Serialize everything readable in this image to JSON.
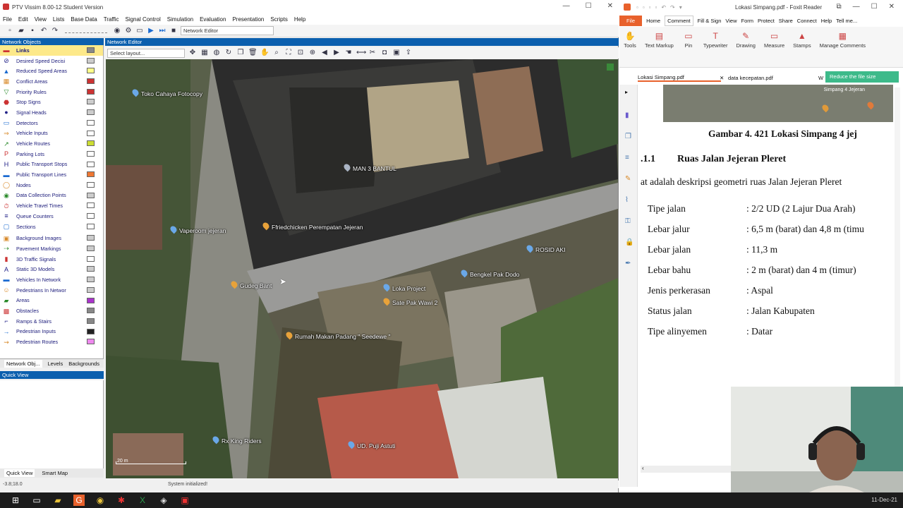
{
  "vissim": {
    "title": "PTV Vissim 8.00-12 Student Version",
    "menu": [
      "File",
      "Edit",
      "View",
      "Lists",
      "Base Data",
      "Traffic",
      "Signal Control",
      "Simulation",
      "Evaluation",
      "Presentation",
      "Scripts",
      "Help"
    ],
    "toolbar_combo": "Network Editor",
    "panel_network_objects": "Network Objects",
    "panel_network_editor": "Network Editor",
    "layout_select": "Select layout...",
    "network_objects": [
      {
        "label": "Links",
        "icon": "link-icon",
        "selected": true
      },
      {
        "label": "Desired Speed Decisi",
        "icon": "speed-sign-icon"
      },
      {
        "label": "Reduced Speed Areas",
        "icon": "warning-sign-icon"
      },
      {
        "label": "Conflict Areas",
        "icon": "conflict-icon"
      },
      {
        "label": "Priority Rules",
        "icon": "priority-icon"
      },
      {
        "label": "Stop Signs",
        "icon": "stop-icon"
      },
      {
        "label": "Signal Heads",
        "icon": "signal-head-icon"
      },
      {
        "label": "Detectors",
        "icon": "detector-icon"
      },
      {
        "label": "Vehicle Inputs",
        "icon": "vehicle-input-icon"
      },
      {
        "label": "Vehicle Routes",
        "icon": "route-icon"
      },
      {
        "label": "Parking Lots",
        "icon": "parking-icon"
      },
      {
        "label": "Public Transport Stops",
        "icon": "bus-stop-icon"
      },
      {
        "label": "Public Transport Lines",
        "icon": "bus-line-icon"
      },
      {
        "label": "Nodes",
        "icon": "node-icon"
      },
      {
        "label": "Data Collection Points",
        "icon": "collection-icon"
      },
      {
        "label": "Vehicle Travel Times",
        "icon": "travel-time-icon"
      },
      {
        "label": "Queue Counters",
        "icon": "queue-icon"
      },
      {
        "label": "Sections",
        "icon": "section-icon"
      },
      {
        "label": "Background Images",
        "icon": "image-icon"
      },
      {
        "label": "Pavement Markings",
        "icon": "marking-icon"
      },
      {
        "label": "3D Traffic Signals",
        "icon": "3d-signal-icon"
      },
      {
        "label": "Static 3D Models",
        "icon": "3d-model-icon"
      },
      {
        "label": "Vehicles In Network",
        "icon": "vehicle-icon"
      },
      {
        "label": "Pedestrians In Networ",
        "icon": "pedestrian-icon"
      },
      {
        "label": "Areas",
        "icon": "area-icon"
      },
      {
        "label": "Obstacles",
        "icon": "obstacle-icon"
      },
      {
        "label": "Ramps & Stairs",
        "icon": "stairs-icon"
      },
      {
        "label": "Pedestrian Inputs",
        "icon": "ped-input-icon"
      },
      {
        "label": "Pedestrian Routes",
        "icon": "ped-route-icon"
      }
    ],
    "left_tabs": [
      "Network Obj...",
      "Levels",
      "Backgrounds"
    ],
    "quick_view_title": "Quick View",
    "bottom_tabs": [
      "Quick View",
      "Smart Map"
    ],
    "status_left": "-3.8;18.0",
    "status_center": "System initialized!",
    "scale_label": "20 m",
    "map_places": [
      {
        "label": "Toko Cahaya Fotocopy",
        "kind": "shop"
      },
      {
        "label": "MAN 3 BANTUL",
        "kind": "school"
      },
      {
        "label": "Vaperoom jejeran",
        "kind": "shop"
      },
      {
        "label": "Ffriedchicken Perempatan Jejeran",
        "kind": "food"
      },
      {
        "label": "ROSID AKI",
        "kind": "shop"
      },
      {
        "label": "Bengkel Pak Dodo",
        "kind": "shop"
      },
      {
        "label": "Gudeg Bant",
        "kind": "food"
      },
      {
        "label": "Loka Project",
        "kind": "shop"
      },
      {
        "label": "Sate Pak Wawi 2",
        "kind": "food"
      },
      {
        "label": "Rumah Makan Padang \" Seedewe \"",
        "kind": "food"
      },
      {
        "label": "Rx King Riders",
        "kind": "shop"
      },
      {
        "label": "UD. Puji Astuti",
        "kind": "shop"
      }
    ]
  },
  "foxit": {
    "title": "Lokasi Simpang.pdf - Foxit Reader",
    "tabs": [
      "File",
      "Home",
      "Comment",
      "Fill & Sign",
      "View",
      "Form",
      "Protect",
      "Share",
      "Connect",
      "Help",
      "Tell me..."
    ],
    "active_tab": "Comment",
    "ribbon": [
      {
        "label": "Tools",
        "icon": "hand-icon"
      },
      {
        "label": "Text Markup",
        "icon": "text-markup-icon"
      },
      {
        "label": "Pin",
        "icon": "pin-icon"
      },
      {
        "label": "Typewriter",
        "icon": "typewriter-icon"
      },
      {
        "label": "Drawing",
        "icon": "pencil-icon"
      },
      {
        "label": "Measure",
        "icon": "ruler-icon"
      },
      {
        "label": "Stamps",
        "icon": "stamp-icon"
      },
      {
        "label": "Manage Comments",
        "icon": "comments-icon"
      }
    ],
    "doc_tabs": [
      "Lokasi Simpang.pdf",
      "data kecepatan.pdf",
      "W"
    ],
    "reduce_button": "Reduce the file size",
    "map_caption": "Simpang 4 Jejeran",
    "figure_caption": "Gambar 4. 421 Lokasi Simpang 4 jej",
    "section_heading_num": ".1.1",
    "section_heading": "Ruas Jalan Jejeran Pleret",
    "intro": "at adalah deskripsi geometri ruas Jalan Jejeran Pleret",
    "rows": [
      {
        "key": "Tipe jalan",
        "value": ": 2/2 UD (2 Lajur Dua Arah)"
      },
      {
        "key": "Lebar jalur",
        "value": ": 6,5 m (barat) dan 4,8 m (timu"
      },
      {
        "key": "Lebar jalan",
        "value": ": 11,3 m"
      },
      {
        "key": "Lebar bahu",
        "value": ": 2 m (barat) dan 4 m (timur)"
      },
      {
        "key": "Jenis perkerasan",
        "value": ": Aspal"
      },
      {
        "key": "Status jalan",
        "value": ": Jalan Kabupaten"
      },
      {
        "key": "Tipe alinyemen",
        "value": ": Datar"
      }
    ]
  },
  "taskbar": {
    "icons": [
      "windows-icon",
      "task-view-icon",
      "file-explorer-icon",
      "foxit-icon",
      "chrome-icon",
      "app-icon",
      "excel-icon",
      "vissim-icon",
      "app-red-icon"
    ],
    "date": "11-Dec-21"
  }
}
